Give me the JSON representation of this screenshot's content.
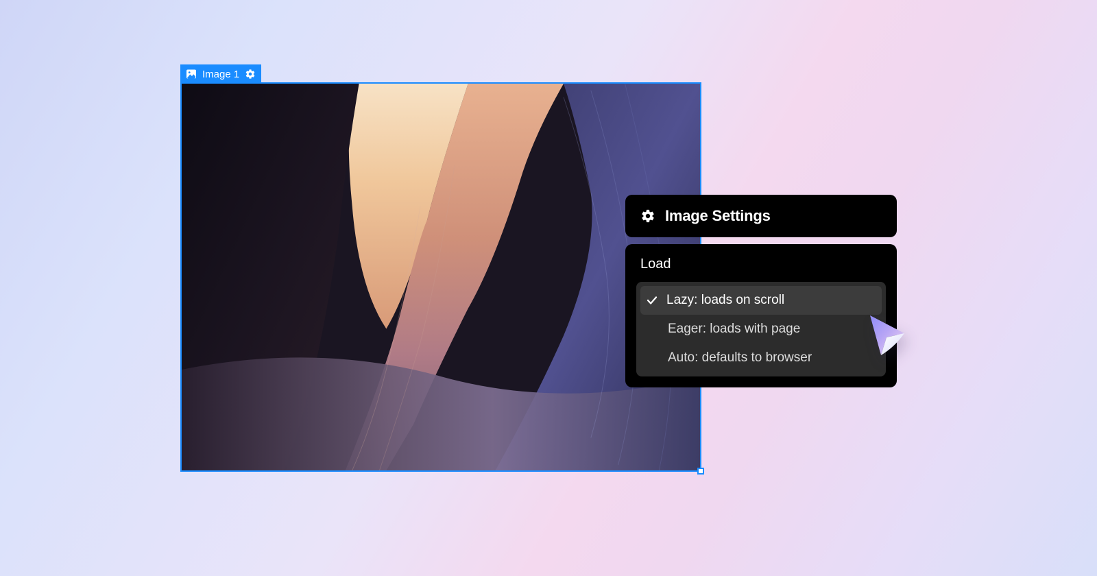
{
  "selection": {
    "label": "Image 1"
  },
  "panel": {
    "title": "Image Settings",
    "section_label": "Load",
    "options": [
      {
        "label": "Lazy: loads on scroll",
        "selected": true
      },
      {
        "label": "Eager: loads with page",
        "selected": false
      },
      {
        "label": "Auto: defaults to browser",
        "selected": false
      }
    ]
  }
}
